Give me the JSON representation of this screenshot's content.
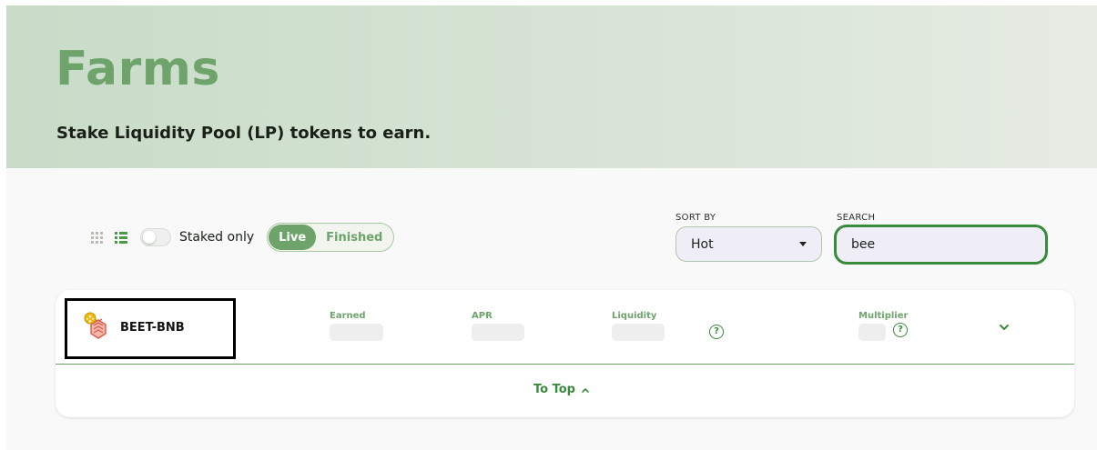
{
  "hero": {
    "title": "Farms",
    "subtitle": "Stake Liquidity Pool (LP) tokens to earn."
  },
  "controls": {
    "grid_view_icon": "grid-icon",
    "list_view_icon": "list-icon",
    "staked_only_label": "Staked only",
    "staked_only_on": false,
    "segment": {
      "live_label": "Live",
      "finished_label": "Finished",
      "active": "live"
    }
  },
  "sort": {
    "label": "SORT BY",
    "value": "Hot"
  },
  "search": {
    "label": "SEARCH",
    "value": "bee"
  },
  "farm_row": {
    "pair_name": "BEET-BNB",
    "columns": {
      "earned": "Earned",
      "apr": "APR",
      "liquidity": "Liquidity",
      "multiplier": "Multiplier"
    },
    "help_icon_glyph": "?"
  },
  "footer": {
    "to_top_label": "To Top"
  },
  "colors": {
    "accent": "#6ea46c",
    "accent_dark": "#3a8a3c",
    "text": "#1a1f1a"
  }
}
